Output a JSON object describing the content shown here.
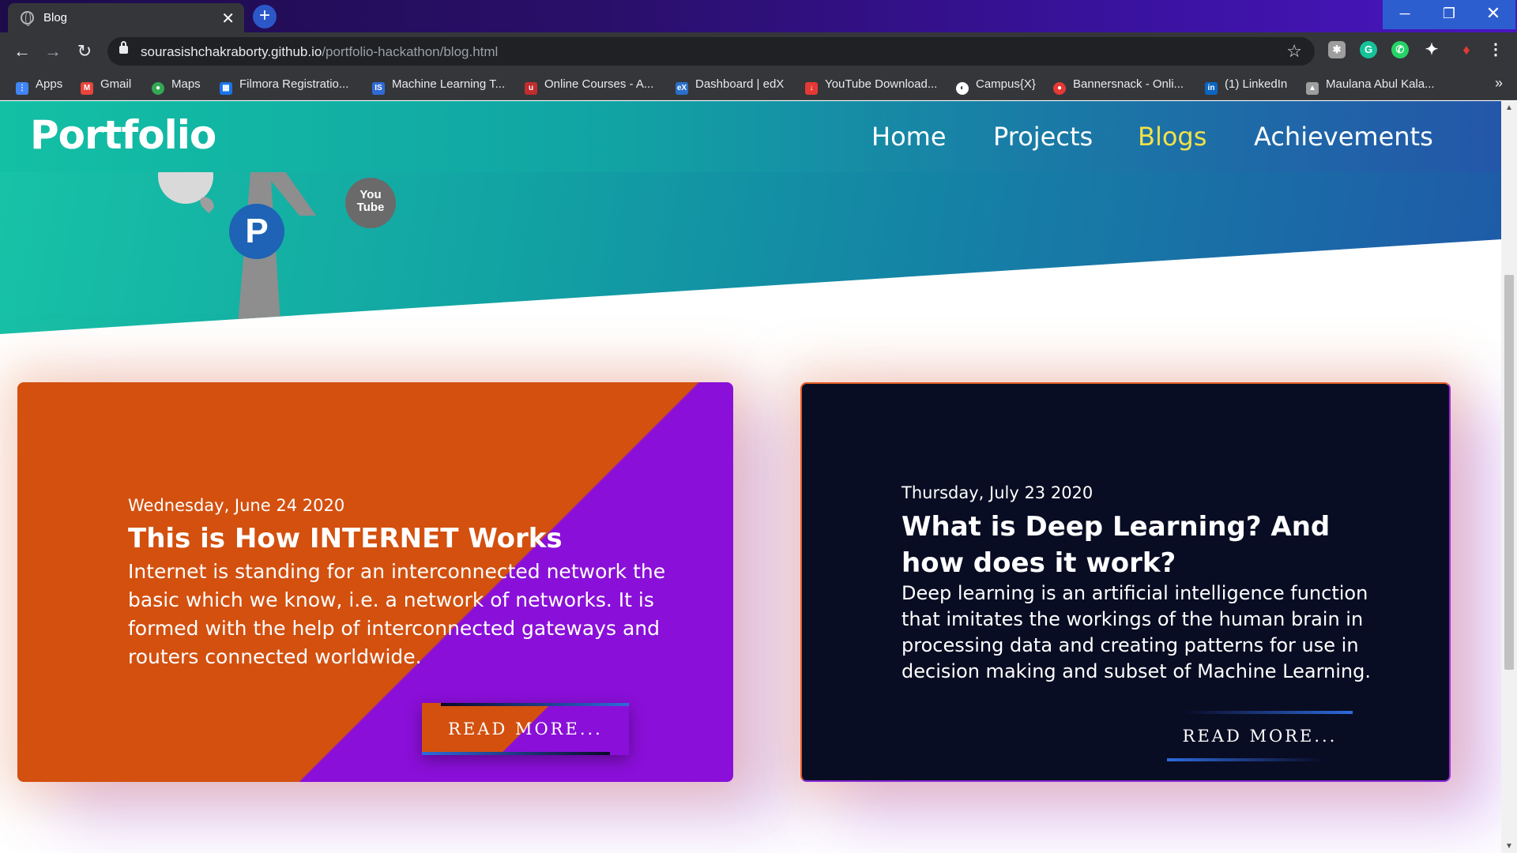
{
  "browser": {
    "tab_title": "Blog",
    "tab_close": "✕",
    "new_tab": "+",
    "url_host": "sourasishchakraborty.github.io",
    "url_path": "/portfolio-hackathon/blog.html",
    "window_min": "─",
    "window_max": "❐",
    "window_close": "✕"
  },
  "bookmarks": [
    {
      "label": "Apps",
      "icon": "apps-grid-icon",
      "color": "#e8453c"
    },
    {
      "label": "Gmail",
      "icon": "gmail-icon",
      "color": "#e8453c"
    },
    {
      "label": "Maps",
      "icon": "maps-pin-icon",
      "color": "#34a853"
    },
    {
      "label": "Filmora Registratio...",
      "icon": "filmora-icon",
      "color": "#1a73e8"
    },
    {
      "label": "Machine Learning T...",
      "icon": "ml-icon",
      "color": "#2f6bd8"
    },
    {
      "label": "Online Courses - A...",
      "icon": "udemy-icon",
      "color": "#c12d2d"
    },
    {
      "label": "Dashboard | edX",
      "icon": "edx-icon",
      "color": "#2a6fc9"
    },
    {
      "label": "YouTube Download...",
      "icon": "download-icon",
      "color": "#e53935"
    },
    {
      "label": "Campus{X}",
      "icon": "campusx-icon",
      "color": "#ffffff"
    },
    {
      "label": "Bannersnack - Onli...",
      "icon": "bannersnack-icon",
      "color": "#e53935"
    },
    {
      "label": "(1) LinkedIn",
      "icon": "linkedin-icon",
      "color": "#0a66c2"
    },
    {
      "label": "Maulana Abul Kala...",
      "icon": "graduation-cap-icon",
      "color": "#9e9e9e"
    }
  ],
  "bookmarks_more": "»",
  "nav": {
    "logo": "Portfolio",
    "links": [
      "Home",
      "Projects",
      "Blogs",
      "Achievements"
    ],
    "active": "Blogs",
    "active_color": "#f3e14a"
  },
  "hero_icons": {
    "pinterest": "P",
    "youtube_top": "You",
    "youtube_bottom": "Tube"
  },
  "cards": [
    {
      "date": "Wednesday, June 24 2020",
      "title": "This is How INTERNET Works",
      "body": "Internet is standing for an interconnected network the basic which we know, i.e. a network of networks. It is formed with the help of interconnected gateways and routers connected worldwide.",
      "button": "READ MORE..."
    },
    {
      "date": "Thursday, July 23 2020",
      "title": "What is Deep Learning? And how does it work?",
      "body": "Deep learning is an artificial intelligence function that imitates the workings of the human brain in processing data and creating patterns for use in decision making and subset of Machine Learning.",
      "button": "READ MORE..."
    }
  ]
}
